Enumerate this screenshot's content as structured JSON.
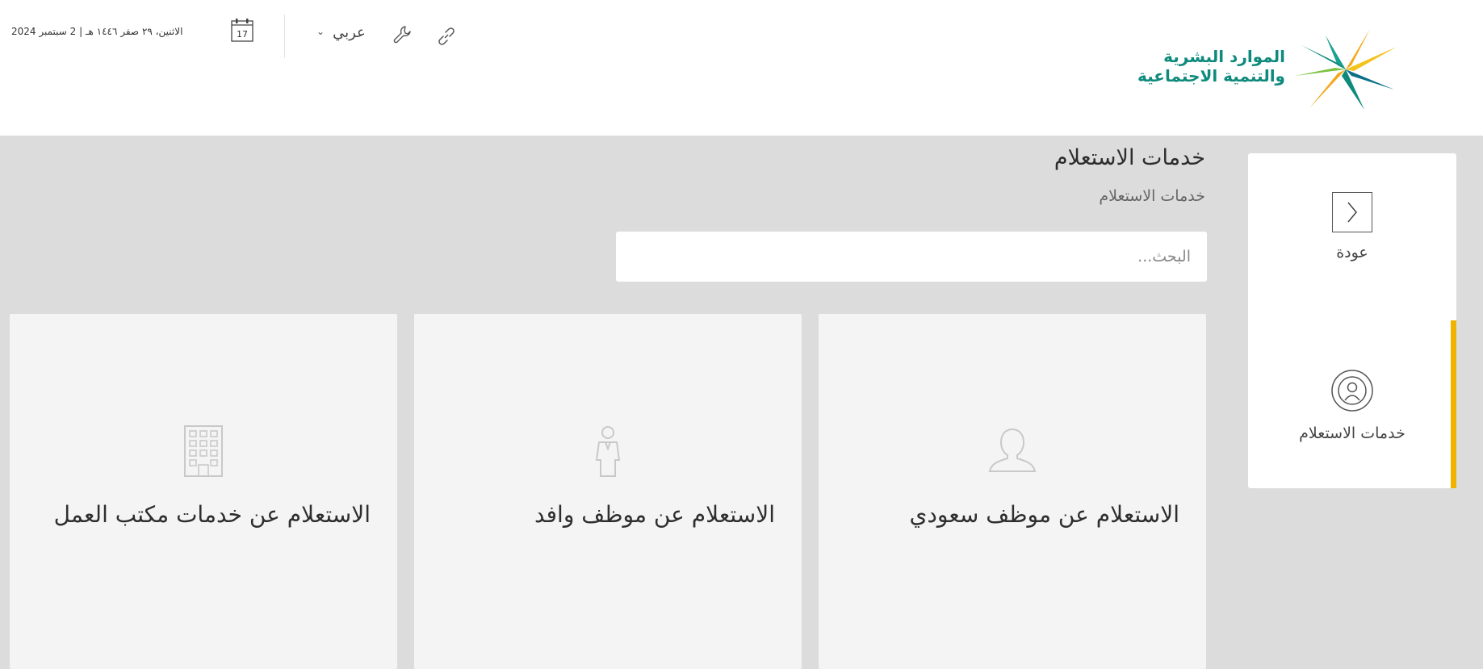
{
  "header": {
    "logo_line1": "الموارد البشرية",
    "logo_line2": "والتنمية الاجتماعية",
    "date_text": "الاثنين، ٢٩ صفر ١٤٤٦ هـ | 2 سبتمبر 2024",
    "calendar_day": "17",
    "language_label": "عربي",
    "icons": [
      "calendar-icon",
      "chevron-down-icon",
      "wrench-icon",
      "link-icon"
    ]
  },
  "main": {
    "title": "خدمات الاستعلام",
    "breadcrumb": "خدمات الاستعلام",
    "search_placeholder": "البحث...",
    "cards": [
      {
        "title": "الاستعلام عن موظف سعودي",
        "icon": "user-icon"
      },
      {
        "title": "الاستعلام عن موظف وافد",
        "icon": "employee-icon"
      },
      {
        "title": "الاستعلام عن خدمات مكتب العمل",
        "icon": "building-icon"
      }
    ]
  },
  "sidebar": {
    "back_label": "عودة",
    "service_label": "خدمات الاستعلام",
    "active_color": "#f0b400"
  },
  "colors": {
    "brand_green": "#0e8a7d",
    "brand_yellow": "#f3a81b",
    "page_bg": "#dcdcdc"
  }
}
